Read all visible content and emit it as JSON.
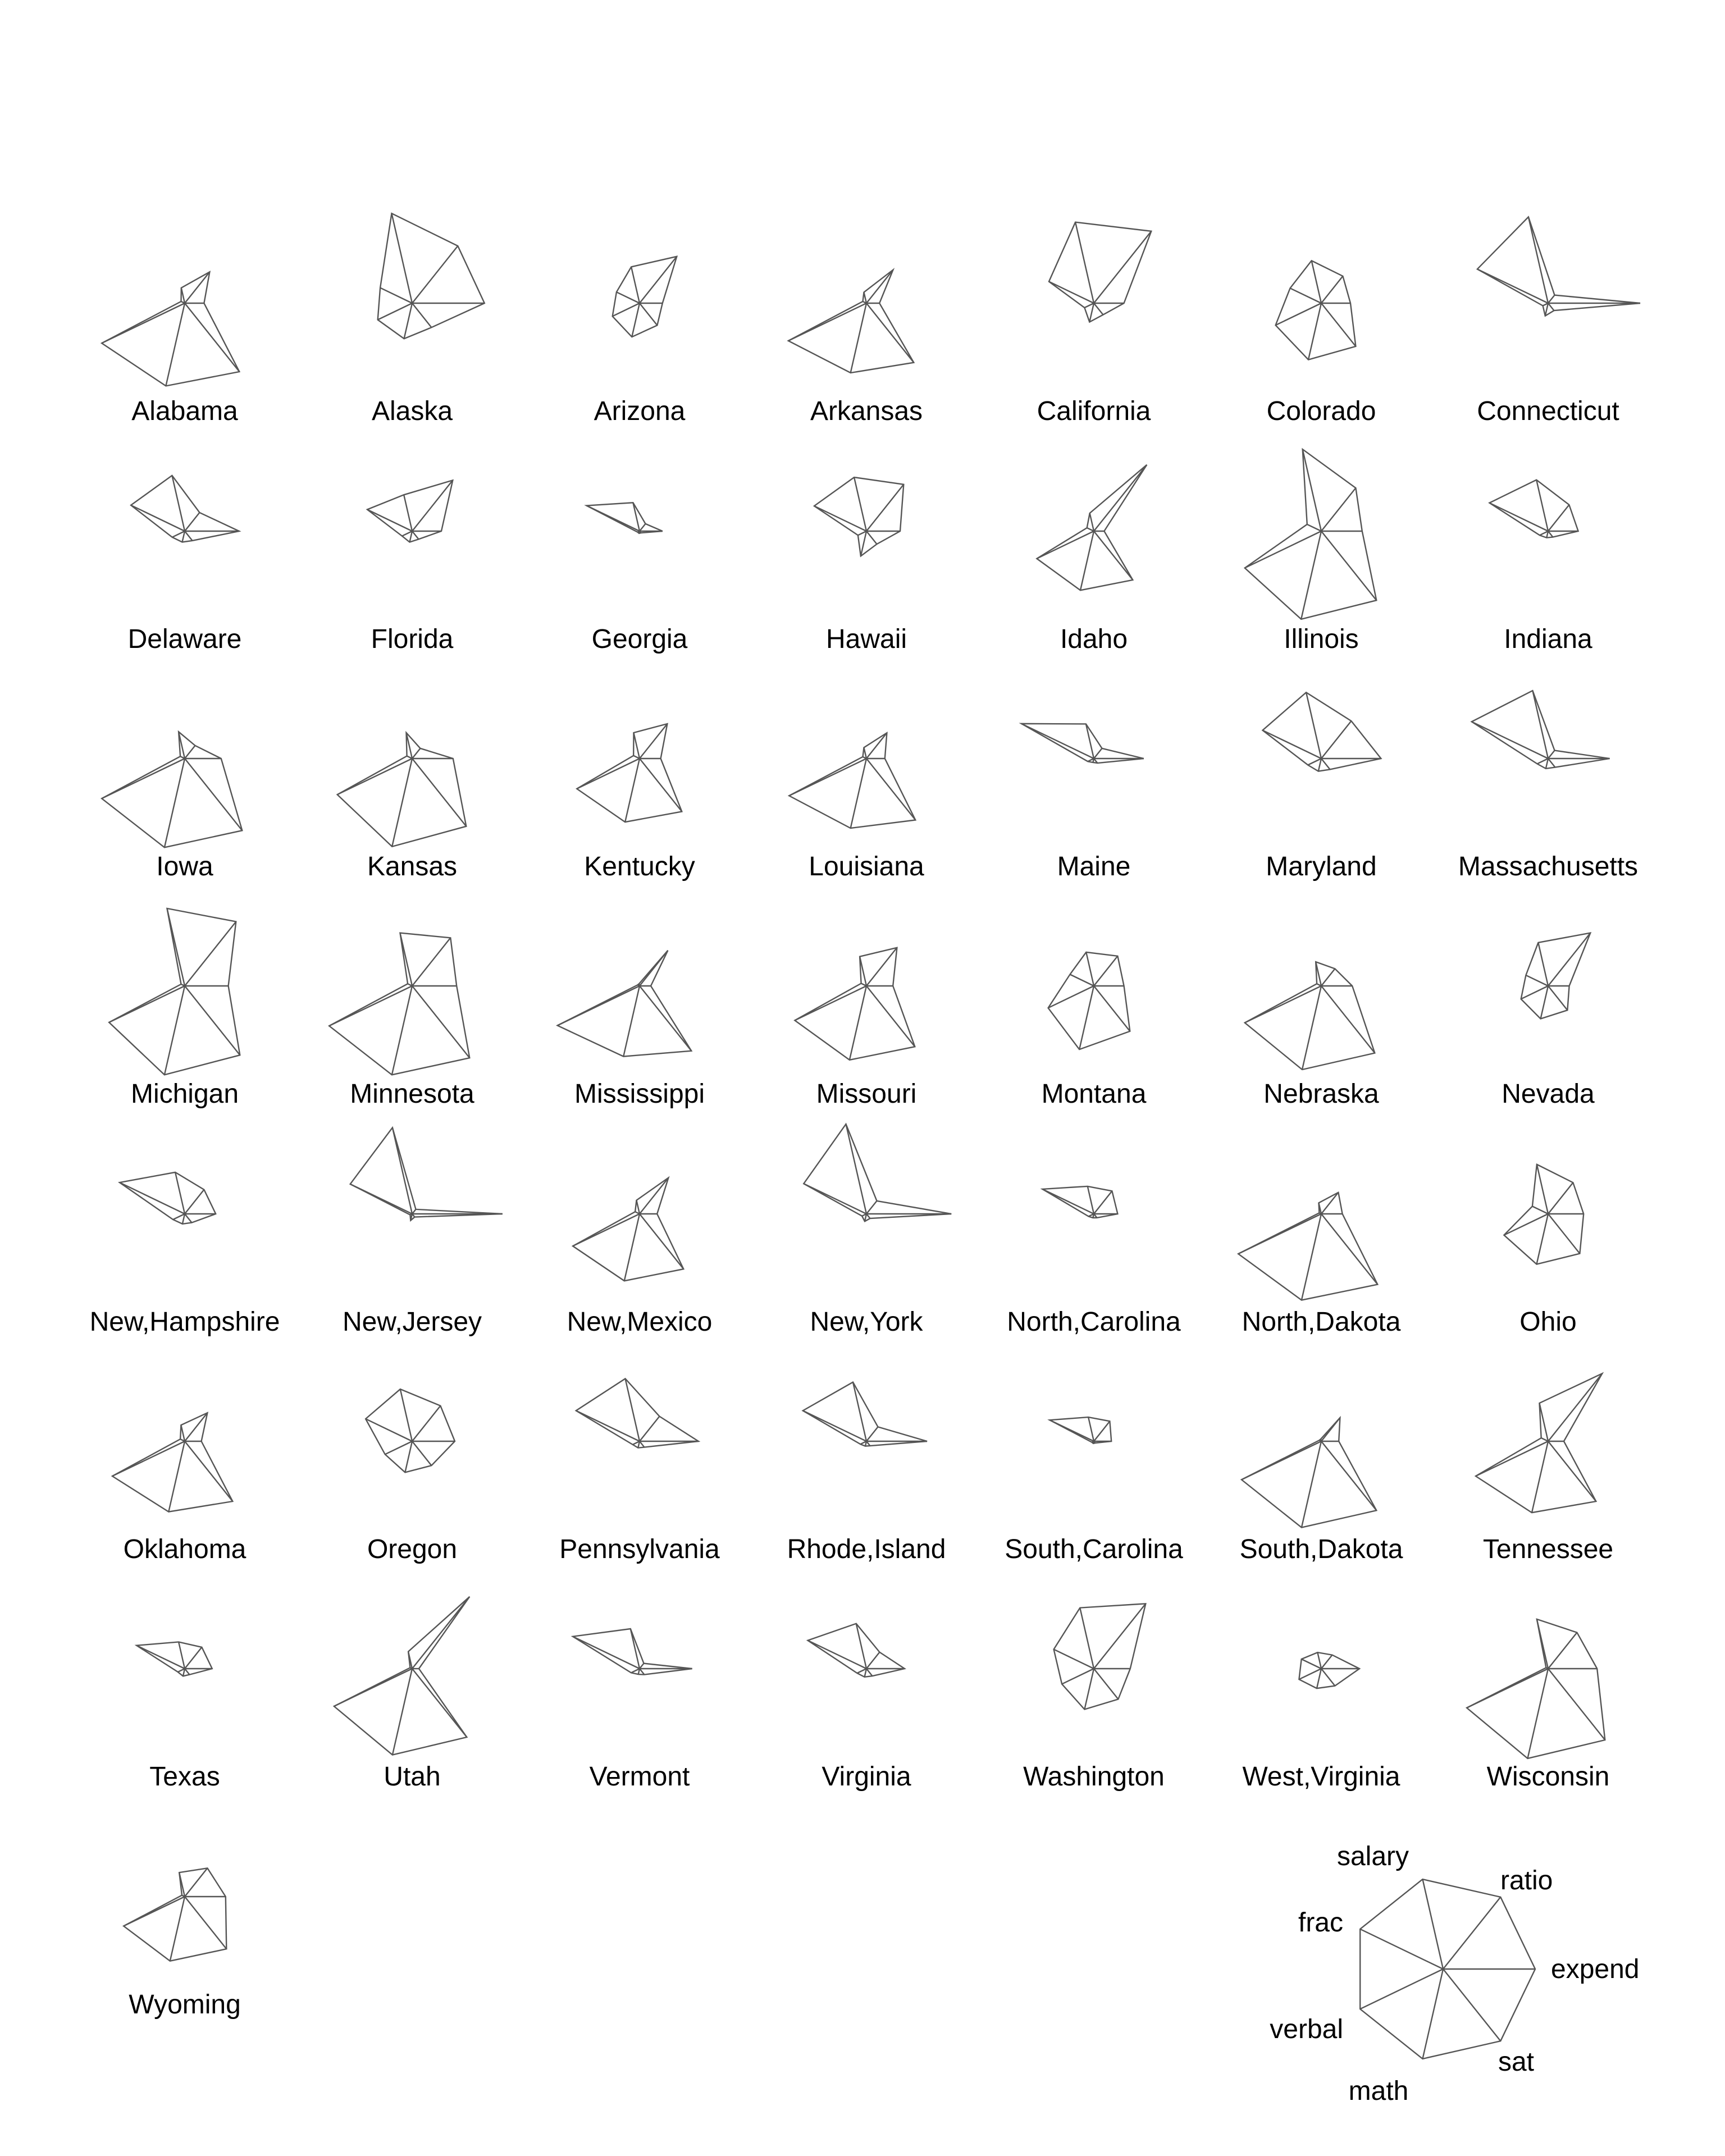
{
  "chart_data": {
    "type": "star",
    "variables": [
      "expend",
      "ratio",
      "salary",
      "frac",
      "verbal",
      "math",
      "sat"
    ],
    "key_labels": {
      "expend": "expend",
      "ratio": "ratio",
      "salary": "salary",
      "frac": "frac",
      "verbal": "verbal",
      "math": "math",
      "sat": "sat"
    },
    "states": [
      {
        "name": "Alabama",
        "values": [
          0.19,
          0.42,
          0.15,
          0.02,
          1.0,
          0.92,
          0.95
        ]
      },
      {
        "name": "Alaska",
        "values": [
          0.78,
          0.79,
          1.0,
          0.37,
          0.4,
          0.38,
          0.32
        ]
      },
      {
        "name": "Arizona",
        "values": [
          0.23,
          0.64,
          0.39,
          0.26,
          0.31,
          0.36,
          0.29
        ]
      },
      {
        "name": "Arkansas",
        "values": [
          0.12,
          0.45,
          0.1,
          0.02,
          0.94,
          0.77,
          0.82
        ]
      },
      {
        "name": "California",
        "values": [
          0.31,
          1.0,
          0.9,
          0.53,
          0.09,
          0.19,
          0.14
        ]
      },
      {
        "name": "Colorado",
        "values": [
          0.3,
          0.36,
          0.46,
          0.36,
          0.54,
          0.62,
          0.59
        ]
      },
      {
        "name": "Connecticut",
        "values": [
          1.0,
          0.09,
          0.96,
          0.85,
          0.04,
          0.12,
          0.08
        ]
      },
      {
        "name": "Delaware",
        "values": [
          0.58,
          0.24,
          0.61,
          0.64,
          0.13,
          0.1,
          0.11
        ]
      },
      {
        "name": "Florida",
        "values": [
          0.3,
          0.7,
          0.39,
          0.53,
          0.1,
          0.1,
          0.09
        ]
      },
      {
        "name": "Georgia",
        "values": [
          0.23,
          0.08,
          0.3,
          0.63,
          0.0,
          0.0,
          0.0
        ]
      },
      {
        "name": "Hawaii",
        "values": [
          0.35,
          0.64,
          0.59,
          0.62,
          0.08,
          0.26,
          0.16
        ]
      },
      {
        "name": "Idaho",
        "values": [
          0.09,
          0.92,
          0.18,
          0.06,
          0.68,
          0.65,
          0.67
        ]
      },
      {
        "name": "Illinois",
        "values": [
          0.43,
          0.59,
          0.91,
          0.15,
          0.92,
          0.98,
          0.96
        ]
      },
      {
        "name": "Indiana",
        "values": [
          0.31,
          0.35,
          0.56,
          0.7,
          0.08,
          0.05,
          0.06
        ]
      },
      {
        "name": "Iowa",
        "values": [
          0.38,
          0.16,
          0.28,
          0.03,
          1.0,
          0.99,
          1.0
        ]
      },
      {
        "name": "Kansas",
        "values": [
          0.43,
          0.12,
          0.27,
          0.04,
          0.9,
          0.98,
          0.94
        ]
      },
      {
        "name": "Kentucky",
        "values": [
          0.21,
          0.47,
          0.27,
          0.05,
          0.75,
          0.7,
          0.73
        ]
      },
      {
        "name": "Louisiana",
        "values": [
          0.18,
          0.34,
          0.1,
          0.02,
          0.93,
          0.77,
          0.85
        ]
      },
      {
        "name": "Maine",
        "values": [
          0.53,
          0.12,
          0.37,
          0.87,
          0.05,
          0.02,
          0.04
        ]
      },
      {
        "name": "Maryland",
        "values": [
          0.64,
          0.51,
          0.73,
          0.7,
          0.14,
          0.12,
          0.13
        ]
      },
      {
        "name": "Massachusetts",
        "values": [
          0.66,
          0.09,
          0.75,
          0.92,
          0.11,
          0.09,
          0.1
        ]
      },
      {
        "name": "Michigan",
        "values": [
          0.46,
          0.89,
          0.86,
          0.02,
          0.91,
          0.99,
          0.96
        ]
      },
      {
        "name": "Minnesota",
        "values": [
          0.47,
          0.66,
          0.58,
          0.03,
          1.0,
          0.99,
          1.0
        ]
      },
      {
        "name": "Mississippi",
        "values": [
          0.1,
          0.48,
          0.0,
          0.0,
          0.99,
          0.78,
          0.9
        ]
      },
      {
        "name": "Missouri",
        "values": [
          0.27,
          0.52,
          0.31,
          0.04,
          0.86,
          0.82,
          0.84
        ]
      },
      {
        "name": "Montana",
        "values": [
          0.31,
          0.4,
          0.36,
          0.27,
          0.54,
          0.7,
          0.62
        ]
      },
      {
        "name": "Nebraska",
        "values": [
          0.32,
          0.22,
          0.25,
          0.03,
          0.92,
          0.93,
          0.93
        ]
      },
      {
        "name": "Nevada",
        "values": [
          0.21,
          0.73,
          0.47,
          0.25,
          0.31,
          0.35,
          0.32
        ]
      },
      {
        "name": "New,Hampshire",
        "values": [
          0.32,
          0.32,
          0.45,
          0.78,
          0.12,
          0.09,
          0.1
        ]
      },
      {
        "name": "New,Jersey",
        "values": [
          0.98,
          0.04,
          0.96,
          0.74,
          0.0,
          0.05,
          0.02
        ]
      },
      {
        "name": "New,Mexico",
        "values": [
          0.17,
          0.49,
          0.13,
          0.03,
          0.8,
          0.74,
          0.76
        ]
      },
      {
        "name": "New,York",
        "values": [
          0.92,
          0.16,
          1.0,
          0.75,
          0.03,
          0.06,
          0.04
        ]
      },
      {
        "name": "North,Carolina",
        "values": [
          0.24,
          0.3,
          0.29,
          0.61,
          0.04,
          0.02,
          0.03
        ]
      },
      {
        "name": "North,Dakota",
        "values": [
          0.21,
          0.28,
          0.1,
          0.0,
          1.0,
          0.96,
          0.98
        ]
      },
      {
        "name": "Ohio",
        "values": [
          0.37,
          0.42,
          0.54,
          0.17,
          0.52,
          0.55,
          0.54
        ]
      },
      {
        "name": "Oklahoma",
        "values": [
          0.16,
          0.38,
          0.16,
          0.03,
          0.87,
          0.78,
          0.83
        ]
      },
      {
        "name": "Oregon",
        "values": [
          0.45,
          0.48,
          0.57,
          0.55,
          0.31,
          0.33,
          0.32
        ]
      },
      {
        "name": "Pennsylvania",
        "values": [
          0.63,
          0.33,
          0.69,
          0.76,
          0.06,
          0.05,
          0.06
        ]
      },
      {
        "name": "Rhode,Island",
        "values": [
          0.65,
          0.18,
          0.65,
          0.76,
          0.05,
          0.03,
          0.04
        ]
      },
      {
        "name": "South,Carolina",
        "values": [
          0.17,
          0.26,
          0.25,
          0.52,
          0.0,
          0.0,
          0.0
        ]
      },
      {
        "name": "South,Dakota",
        "values": [
          0.17,
          0.31,
          0.0,
          0.0,
          0.96,
          0.96,
          0.96
        ]
      },
      {
        "name": "Tennessee",
        "values": [
          0.15,
          0.94,
          0.41,
          0.06,
          0.87,
          0.79,
          0.83
        ]
      },
      {
        "name": "Texas",
        "values": [
          0.28,
          0.28,
          0.28,
          0.57,
          0.06,
          0.06,
          0.06
        ]
      },
      {
        "name": "Utah",
        "values": [
          0.05,
          1.0,
          0.17,
          0.0,
          0.94,
          0.96,
          0.95
        ]
      },
      {
        "name": "Vermont",
        "values": [
          0.56,
          0.05,
          0.43,
          0.8,
          0.08,
          0.04,
          0.06
        ]
      },
      {
        "name": "Virginia",
        "values": [
          0.4,
          0.21,
          0.49,
          0.7,
          0.09,
          0.07,
          0.08
        ]
      },
      {
        "name": "Washington",
        "values": [
          0.38,
          0.9,
          0.67,
          0.47,
          0.37,
          0.44,
          0.41
        ]
      },
      {
        "name": "West,Virginia",
        "values": [
          0.4,
          0.17,
          0.16,
          0.22,
          0.25,
          0.2,
          0.22
        ]
      },
      {
        "name": "Wisconsin",
        "values": [
          0.52,
          0.49,
          0.54,
          0.0,
          0.98,
          1.0,
          0.99
        ]
      },
      {
        "name": "Wyoming",
        "values": [
          0.43,
          0.38,
          0.25,
          0.01,
          0.73,
          0.71,
          0.72
        ]
      }
    ]
  }
}
